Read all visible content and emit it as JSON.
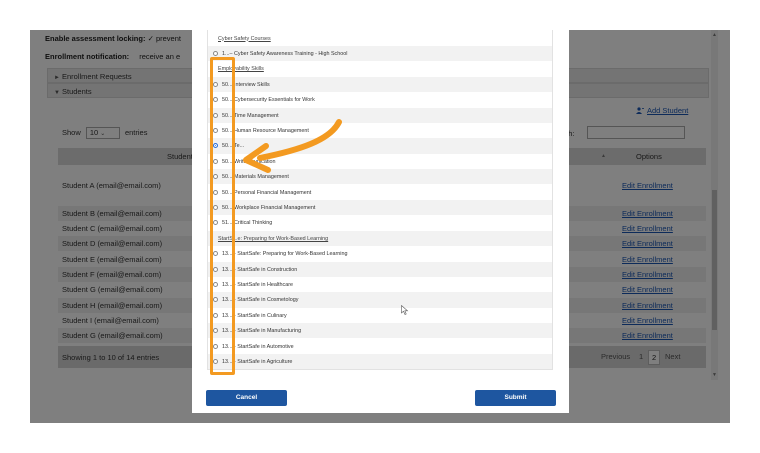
{
  "page": {
    "assessment_locking_label": "Enable assessment locking:",
    "assessment_locking_value": "prevent",
    "enrollment_notification_label": "Enrollment notification:",
    "enrollment_notification_value": "receive an e",
    "sections": [
      {
        "label": "Enrollment Requests",
        "state": "collapsed"
      },
      {
        "label": "Students",
        "state": "expanded"
      }
    ],
    "add_student_label": "Add Student",
    "show_label": "Show",
    "entries_value": "10",
    "entries_label": "entries",
    "search_label": "rch:",
    "search_value": "",
    "columns": {
      "student": "Student",
      "options": "Options"
    },
    "rows": [
      {
        "name": "Student A (email@email.com)",
        "action": "Edit Enrollment"
      },
      {
        "name": "Student B (email@email.com)",
        "action": "Edit Enrollment"
      },
      {
        "name": "Student C (email@email.com)",
        "action": "Edit Enrollment"
      },
      {
        "name": "Student D (email@email.com)",
        "action": "Edit Enrollment"
      },
      {
        "name": "Student E (email@email.com)",
        "action": "Edit Enrollment"
      },
      {
        "name": "Student F (email@email.com)",
        "action": "Edit Enrollment"
      },
      {
        "name": "Student G (email@email.com)",
        "action": "Edit Enrollment"
      },
      {
        "name": "Student H (email@email.com)",
        "action": "Edit Enrollment"
      },
      {
        "name": "Student I (email@email.com)",
        "action": "Edit Enrollment"
      },
      {
        "name": "Student G (email@email.com)",
        "action": "Edit Enrollment"
      }
    ],
    "footer_info": "Showing 1 to 10 of 14 entries",
    "pager": {
      "previous": "Previous",
      "page1": "1",
      "page2": "2",
      "next": "Next"
    }
  },
  "modal": {
    "items": [
      {
        "type": "category",
        "label": "Cyber Safety Courses"
      },
      {
        "type": "course",
        "label": "1...– Cyber Safety Awareness Training - High School",
        "selected": false
      },
      {
        "type": "category",
        "label": "Employability Skills"
      },
      {
        "type": "course",
        "label": "50... Interview Skills",
        "selected": false
      },
      {
        "type": "course",
        "label": "50... Cybersecurity Essentials for Work",
        "selected": false
      },
      {
        "type": "course",
        "label": "50... Time Management",
        "selected": false
      },
      {
        "type": "course",
        "label": "50... Human Resource Management",
        "selected": false
      },
      {
        "type": "course",
        "label": "50... Te...",
        "selected": true
      },
      {
        "type": "course",
        "label": "50... Writ... ...unication",
        "selected": false
      },
      {
        "type": "course",
        "label": "50... Materials Management",
        "selected": false
      },
      {
        "type": "course",
        "label": "50... Personal Financial Management",
        "selected": false
      },
      {
        "type": "course",
        "label": "50... Workplace Financial Management",
        "selected": false
      },
      {
        "type": "course",
        "label": "51... Critical Thinking",
        "selected": false
      },
      {
        "type": "category",
        "label": "StartS...e: Preparing for Work-Based Learning"
      },
      {
        "type": "course",
        "label": "13... - StartSafe: Preparing for Work-Based Learning",
        "selected": false
      },
      {
        "type": "course",
        "label": "13... - StartSafe in Construction",
        "selected": false
      },
      {
        "type": "course",
        "label": "13... - StartSafe in Healthcare",
        "selected": false
      },
      {
        "type": "course",
        "label": "13... - StartSafe in Cosmetology",
        "selected": false
      },
      {
        "type": "course",
        "label": "13... - StartSafe in Culinary",
        "selected": false
      },
      {
        "type": "course",
        "label": "13... - StartSafe in Manufacturing",
        "selected": false
      },
      {
        "type": "course",
        "label": "13... - StartSafe in Automotive",
        "selected": false
      },
      {
        "type": "course",
        "label": "13... - StartSafe in Agriculture",
        "selected": false
      }
    ],
    "cancel_label": "Cancel",
    "submit_label": "Submit"
  },
  "colors": {
    "primary_button": "#1e56a0",
    "link": "#1a56b4",
    "annotation": "#f39a21",
    "selected_radio": "#2d6fd6"
  }
}
